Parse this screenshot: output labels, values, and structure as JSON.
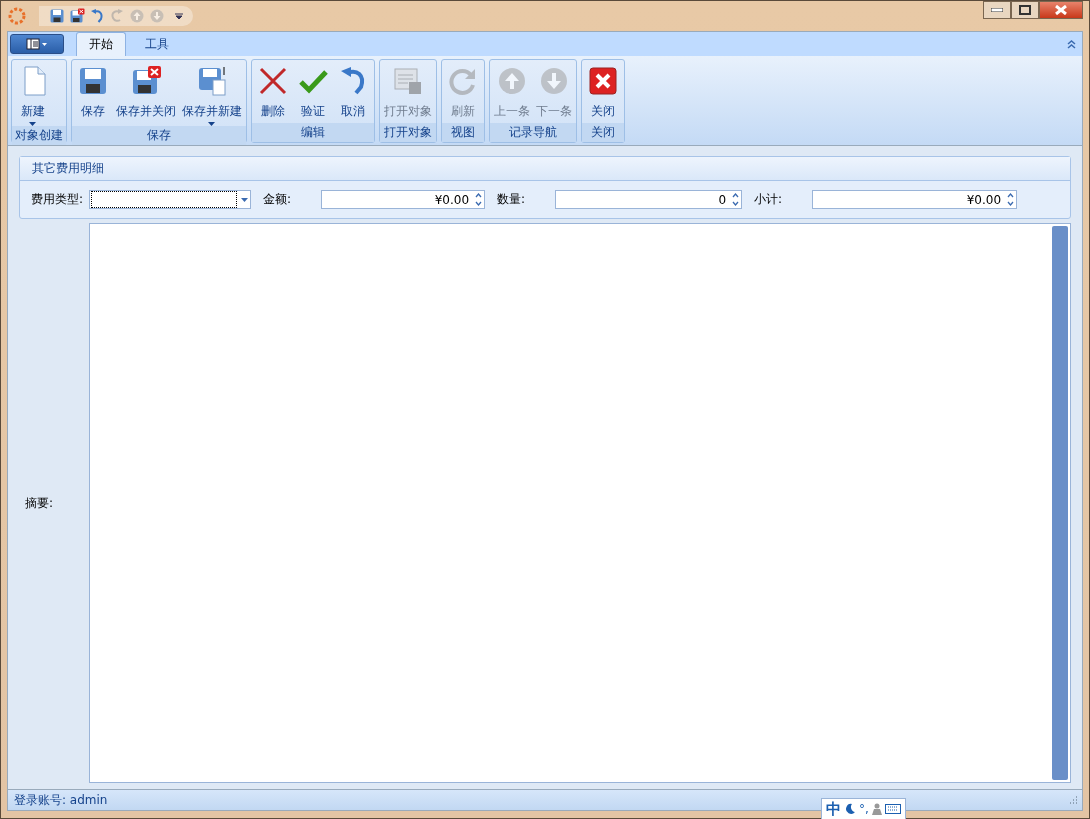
{
  "window": {
    "quick_access": [
      {
        "kind": "save",
        "disabled": false
      },
      {
        "kind": "save-close",
        "disabled": false
      },
      {
        "kind": "undo",
        "disabled": false
      },
      {
        "kind": "redo",
        "disabled": true
      },
      {
        "kind": "up",
        "disabled": true
      },
      {
        "kind": "down",
        "disabled": true
      }
    ]
  },
  "ribbon": {
    "tabs": [
      {
        "label": "开始",
        "selected": true
      },
      {
        "label": "工具",
        "selected": false
      }
    ],
    "groups": [
      {
        "label": "对象创建",
        "buttons": [
          {
            "label": "新建",
            "kind": "new",
            "disabled": false,
            "dropdown": true
          }
        ]
      },
      {
        "label": "保存",
        "buttons": [
          {
            "label": "保存",
            "kind": "save",
            "disabled": false,
            "dropdown": false
          },
          {
            "label": "保存并关闭",
            "kind": "save-close",
            "disabled": false,
            "dropdown": false
          },
          {
            "label": "保存并新建",
            "kind": "save-new",
            "disabled": false,
            "dropdown": true
          }
        ]
      },
      {
        "label": "编辑",
        "buttons": [
          {
            "label": "删除",
            "kind": "delete",
            "disabled": false,
            "dropdown": false
          },
          {
            "label": "验证",
            "kind": "check",
            "disabled": false,
            "dropdown": false
          },
          {
            "label": "取消",
            "kind": "undo",
            "disabled": false,
            "dropdown": false
          }
        ]
      },
      {
        "label": "打开对象",
        "buttons": [
          {
            "label": "打开对象",
            "kind": "open",
            "disabled": true,
            "dropdown": false
          }
        ]
      },
      {
        "label": "视图",
        "buttons": [
          {
            "label": "刷新",
            "kind": "refresh",
            "disabled": true,
            "dropdown": false
          }
        ]
      },
      {
        "label": "记录导航",
        "buttons": [
          {
            "label": "上一条",
            "kind": "up",
            "disabled": true,
            "dropdown": false
          },
          {
            "label": "下一条",
            "kind": "down",
            "disabled": true,
            "dropdown": false
          }
        ]
      },
      {
        "label": "关闭",
        "buttons": [
          {
            "label": "关闭",
            "kind": "close",
            "disabled": false,
            "dropdown": false
          }
        ]
      }
    ]
  },
  "form": {
    "group_title": "其它费用明细",
    "fields": [
      {
        "label": "费用类型:",
        "kind": "combo"
      },
      {
        "label": "金额:",
        "kind": "spin",
        "value": "¥0.00"
      },
      {
        "label": "数量:",
        "kind": "spin",
        "value": "0"
      },
      {
        "label": "小计:",
        "kind": "spin",
        "value": "¥0.00"
      }
    ],
    "memo": {
      "label": "摘要:"
    }
  },
  "status_bar": {
    "text": "登录账号: admin"
  },
  "ime_bar": {
    "mode": "中",
    "punct": "°,"
  }
}
